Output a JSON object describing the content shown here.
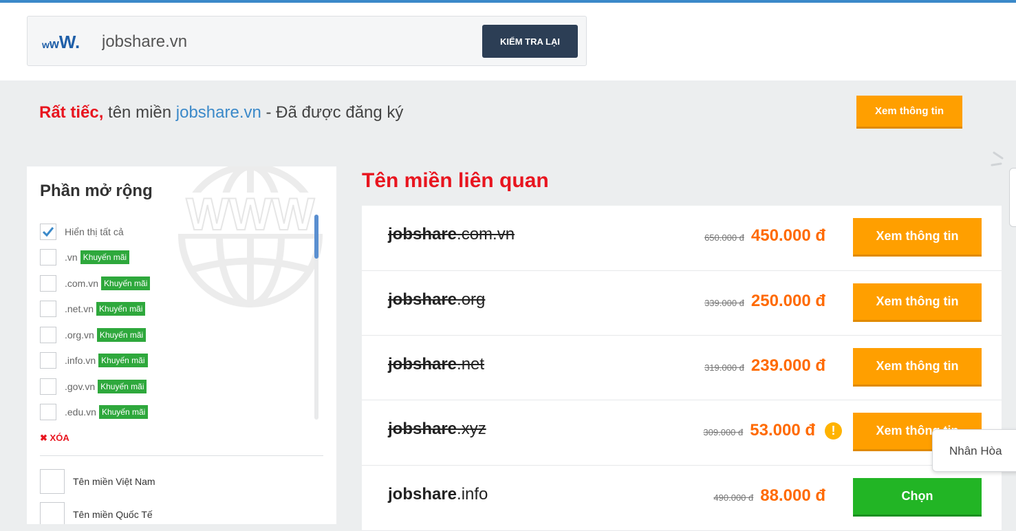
{
  "search": {
    "logo_w1": "w",
    "logo_w2": "w",
    "logo_w3": "W.",
    "domain_value": "jobshare.vn",
    "recheck_label": "KIỂM TRA LẠI"
  },
  "result": {
    "sorry_text": "Rất tiếc,",
    "prefix_text": " tên miền ",
    "domain": "jobshare.vn",
    "suffix_text": " - Đã được đăng ký",
    "info_button": "Xem thông tin"
  },
  "sidebar": {
    "title": "Phần mở rộng",
    "show_all_label": "Hiển thị tất cả",
    "show_all_checked": true,
    "extensions": [
      {
        "label": ".vn",
        "badge": "Khuyến mãi"
      },
      {
        "label": ".com.vn",
        "badge": "Khuyến mãi"
      },
      {
        "label": ".net.vn",
        "badge": "Khuyến mãi"
      },
      {
        "label": ".org.vn",
        "badge": "Khuyến mãi"
      },
      {
        "label": ".info.vn",
        "badge": "Khuyến mãi"
      },
      {
        "label": ".gov.vn",
        "badge": "Khuyến mãi"
      },
      {
        "label": ".edu.vn",
        "badge": "Khuyến mãi"
      }
    ],
    "clear_label": "XÓA",
    "regions": [
      {
        "label": "Tên miền Việt Nam"
      },
      {
        "label": "Tên miền Quốc Tế"
      }
    ]
  },
  "related": {
    "title": "Tên miền liên quan",
    "rows": [
      {
        "sld": "jobshare",
        "tld": ".com.vn",
        "old_price": "650.000 đ",
        "new_price": "450.000 đ",
        "button": "Xem thông tin",
        "status": "taken"
      },
      {
        "sld": "jobshare",
        "tld": ".org",
        "old_price": "339.000 đ",
        "new_price": "250.000 đ",
        "button": "Xem thông tin",
        "status": "taken"
      },
      {
        "sld": "jobshare",
        "tld": ".net",
        "old_price": "319.000 đ",
        "new_price": "239.000 đ",
        "button": "Xem thông tin",
        "status": "taken"
      },
      {
        "sld": "jobshare",
        "tld": ".xyz",
        "old_price": "309.000 đ",
        "new_price": "53.000 đ",
        "button": "Xem thông tin",
        "status": "taken"
      },
      {
        "sld": "jobshare",
        "tld": ".info",
        "old_price": "490.000 đ",
        "new_price": "88.000 đ",
        "button": "Chọn",
        "status": "available"
      }
    ]
  },
  "chat": {
    "tooltip": "Nhân Hòa"
  },
  "colors": {
    "accent_blue": "#3b89c9",
    "sorry_red": "#e8151f",
    "button_orange": "#ff9f00",
    "button_green": "#22b525",
    "price_orange": "#ff6a00",
    "badge_green": "#2ea83c",
    "recheck_navy": "#2c3e55"
  }
}
